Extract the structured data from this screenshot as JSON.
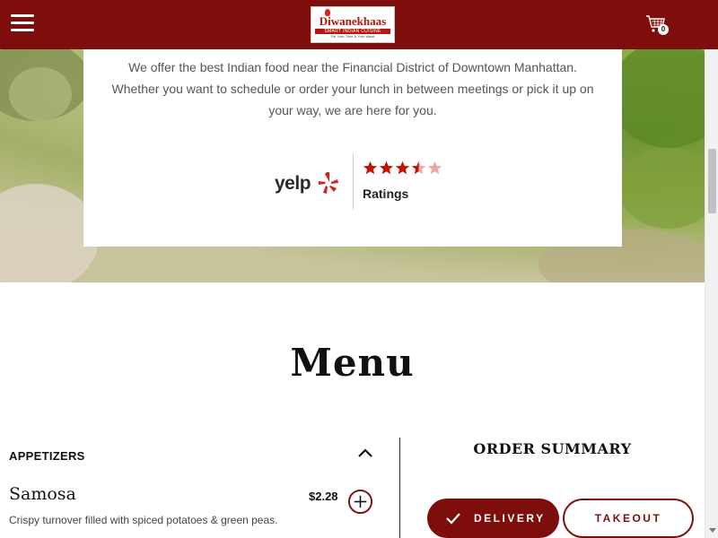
{
  "header": {
    "menu_icon": "hamburger-icon",
    "logo": {
      "name": "Diwanekhaas",
      "tagline": "SMART INDIAN CUISINE",
      "sub": "For Your Time & Your Waist"
    },
    "cart": {
      "icon": "shopping-cart-icon",
      "count": "0"
    },
    "background_color": "#7e0e0b"
  },
  "hero": {
    "intro_text": "We offer the best Indian food near the Financial District of Downtown Manhattan. Whether you want to schedule or order your lunch in between meetings or pick it up on your way, we are here for you.",
    "yelp": {
      "logo_icon": "yelp-logo-icon",
      "word": "yelp"
    },
    "rating": {
      "value": 3.5,
      "max": 5,
      "label": "Ratings",
      "star_color": "#c41200"
    }
  },
  "menu": {
    "title": "Menu",
    "category": {
      "label": "APPETIZERS",
      "toggle_icon": "chevron-up-icon"
    },
    "item": {
      "name": "Samosa",
      "price": "$2.28",
      "description": "Crispy turnover filled with spiced potatoes & green peas.",
      "add_icon": "plus-circle-icon"
    }
  },
  "order": {
    "title": "ORDER SUMMARY",
    "delivery_label": "DELIVERY",
    "delivery_icon": "check-icon",
    "takeout_label": "TAKEOUT",
    "selected": "delivery",
    "accent_color": "#7e0e0b"
  }
}
